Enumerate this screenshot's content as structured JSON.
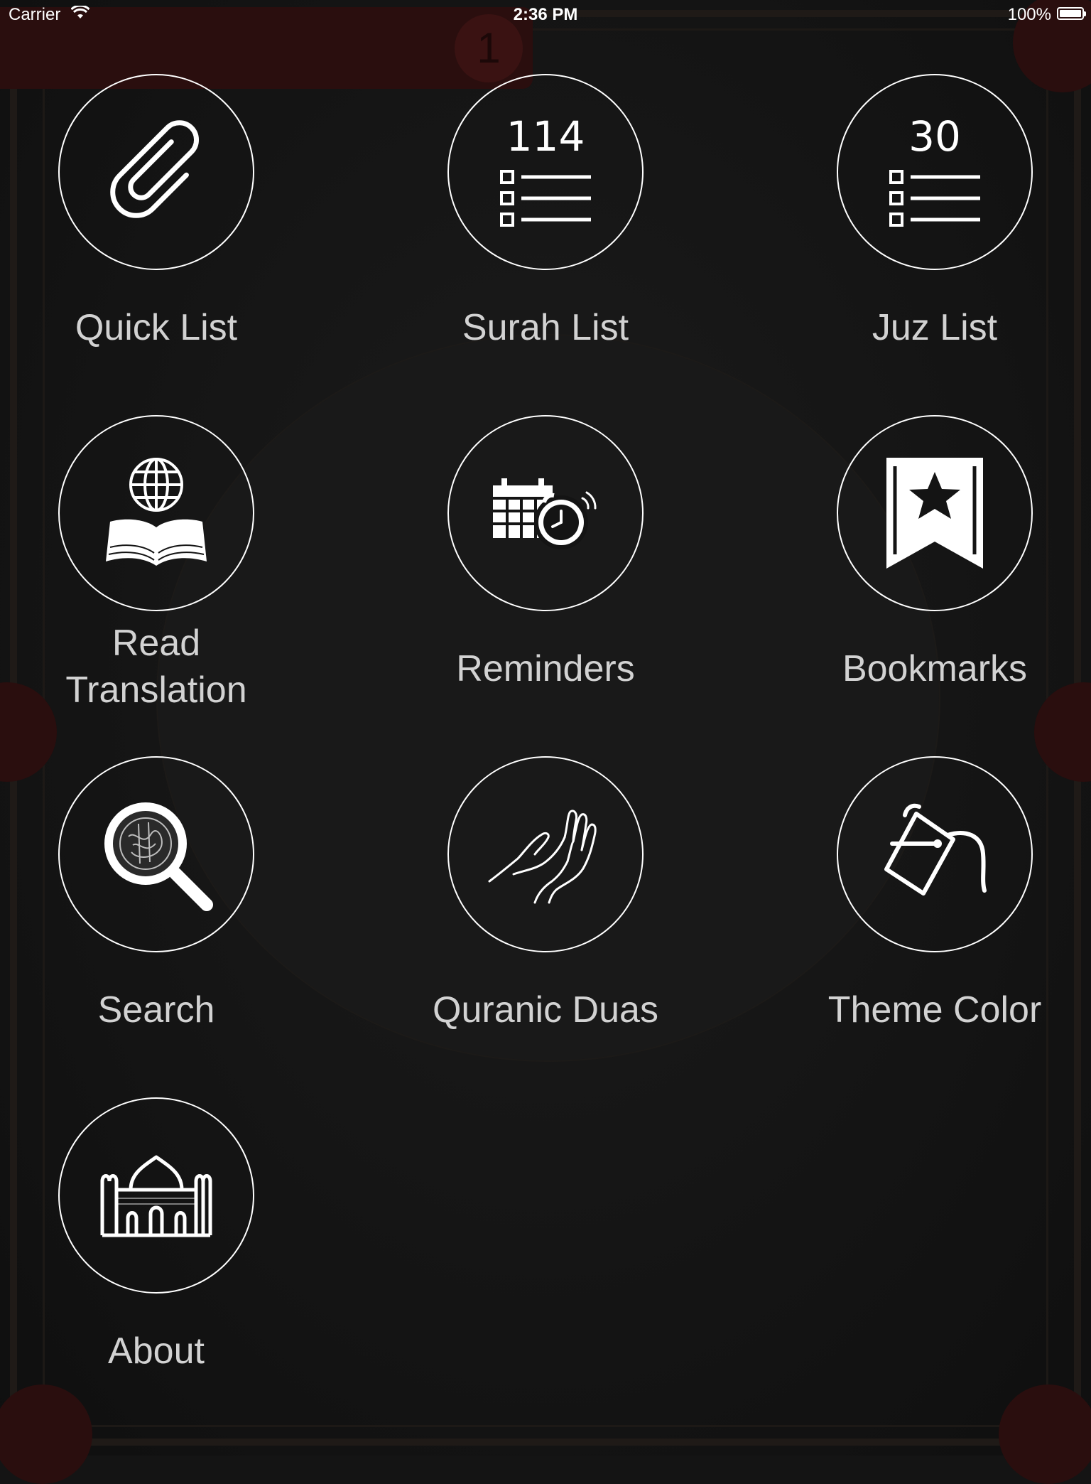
{
  "status_bar": {
    "carrier": "Carrier",
    "time": "2:36 PM",
    "battery": "100%"
  },
  "background": {
    "header_number": "1"
  },
  "menu": {
    "quick_list": "Quick List",
    "surah_list": "Surah List",
    "surah_count": "114",
    "juz_list": "Juz List",
    "juz_count": "30",
    "read_translation_line1": "Read",
    "read_translation_line2": "Translation",
    "reminders": "Reminders",
    "bookmarks": "Bookmarks",
    "search": "Search",
    "quranic_duas": "Quranic Duas",
    "theme_color": "Theme Color",
    "about": "About"
  },
  "icons": {
    "quick_list": "paperclip-icon",
    "surah_list": "list-icon",
    "juz_list": "list-icon",
    "read_translation": "globe-book-icon",
    "reminders": "calendar-alarm-icon",
    "bookmarks": "bookmark-star-icon",
    "search": "magnifier-icon",
    "quranic_duas": "praying-hands-icon",
    "theme_color": "paint-bucket-icon",
    "about": "mosque-icon"
  },
  "colors": {
    "background": "#141414",
    "circle_border": "#ffffff",
    "label_text": "#d2d2d2",
    "accent_dark_red": "#2a0e0e"
  }
}
